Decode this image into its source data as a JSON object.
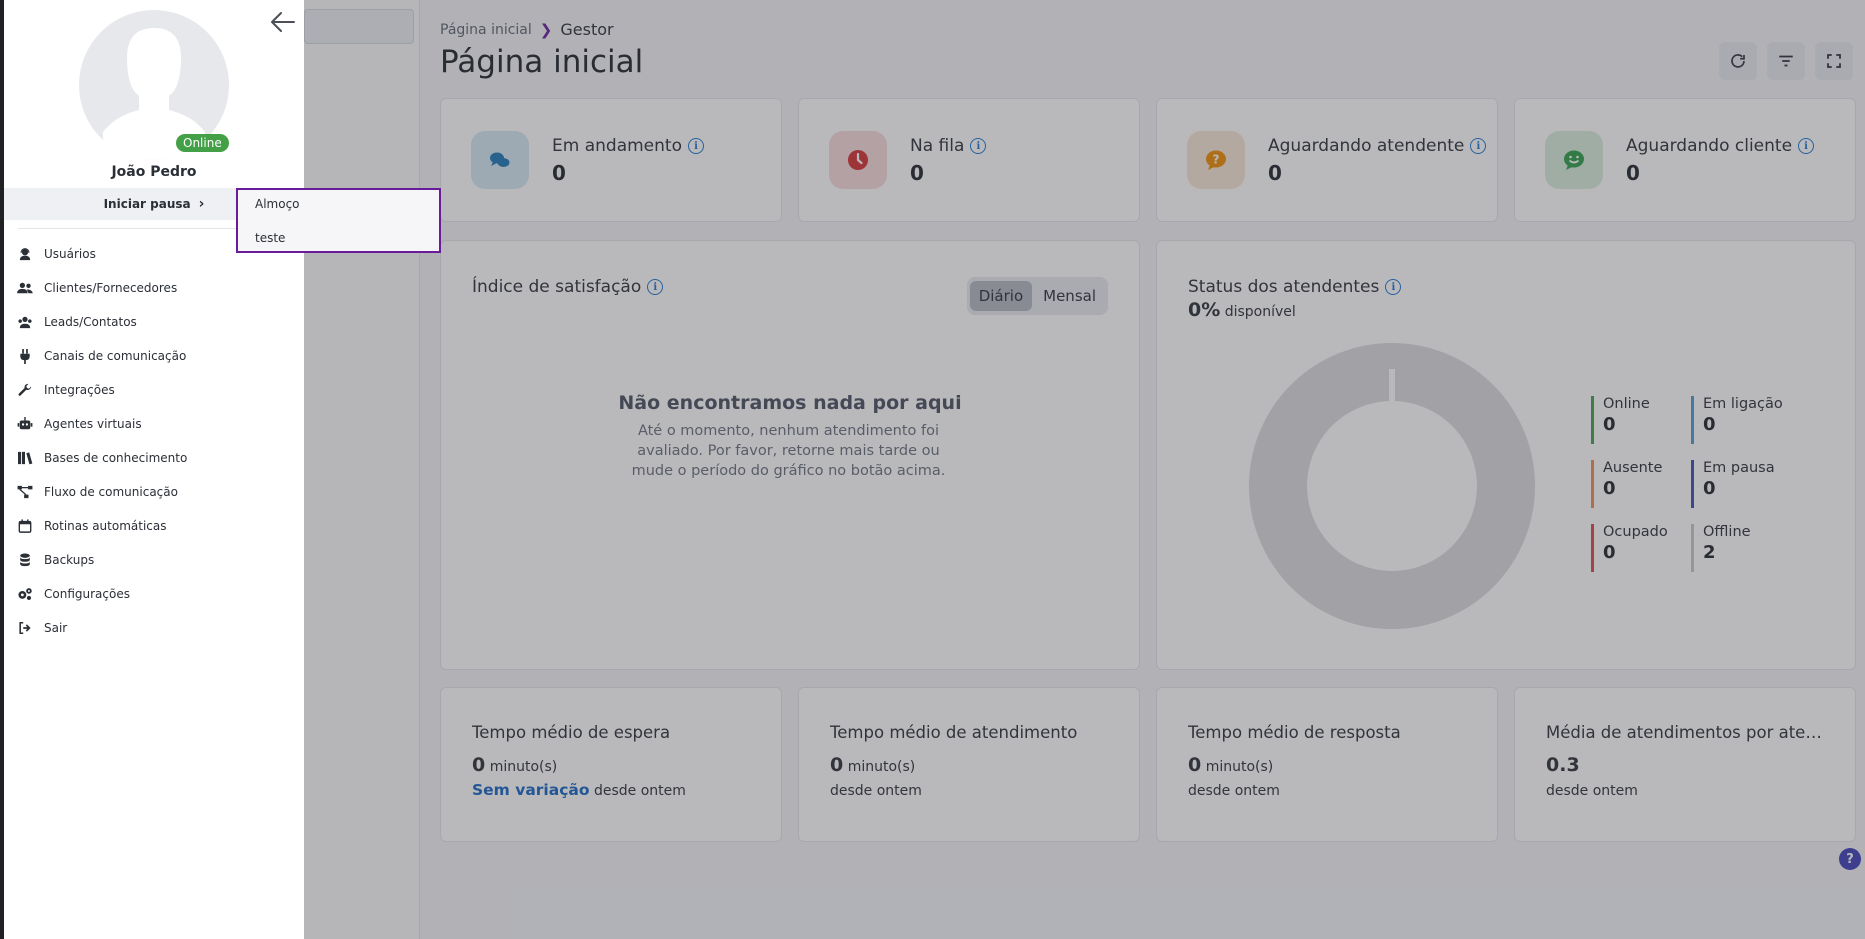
{
  "breadcrumb": {
    "home": "Página inicial",
    "current": "Gestor"
  },
  "page_title": "Página inicial",
  "stats": [
    {
      "label": "Em andamento",
      "value": "0",
      "icon": "chat-bubbles-icon",
      "color": "#1e78b4",
      "bg": "#d5e8f1"
    },
    {
      "label": "Na fila",
      "value": "0",
      "icon": "clock-icon",
      "color": "#d32f2f",
      "bg": "#f6d9da"
    },
    {
      "label": "Aguardando atendente",
      "value": "0",
      "icon": "question-bubble-icon",
      "color": "#ef8c00",
      "bg": "#f8e6d4"
    },
    {
      "label": "Aguardando cliente",
      "value": "0",
      "icon": "smile-bubble-icon",
      "color": "#2e9e47",
      "bg": "#d8ecdc"
    }
  ],
  "satisfaction": {
    "title": "Índice de satisfação",
    "toggle": {
      "daily": "Diário",
      "monthly": "Mensal"
    },
    "empty_title": "Não encontramos nada por aqui",
    "empty_text": "Até o momento, nenhum atendimento foi avaliado. Por favor, retorne mais tarde ou mude o período do gráfico no botão acima."
  },
  "agent_status": {
    "title": "Status dos atendentes",
    "percent": "0%",
    "percent_label": "disponível",
    "legend": [
      {
        "label": "Online",
        "value": "0",
        "color": "#43a047"
      },
      {
        "label": "Em ligação",
        "value": "0",
        "color": "#4a9bd6"
      },
      {
        "label": "Ausente",
        "value": "0",
        "color": "#ef8c4f"
      },
      {
        "label": "Em pausa",
        "value": "0",
        "color": "#3f4bb8"
      },
      {
        "label": "Ocupado",
        "value": "0",
        "color": "#d9484b"
      },
      {
        "label": "Offline",
        "value": "2",
        "color": "#c7c9ce"
      }
    ]
  },
  "metrics": [
    {
      "title": "Tempo médio de espera",
      "value": "0",
      "unit": "minuto(s)",
      "highlight": "Sem variação",
      "since": "desde ontem"
    },
    {
      "title": "Tempo médio de atendimento",
      "value": "0",
      "unit": "minuto(s)",
      "highlight": "",
      "since": "desde ontem"
    },
    {
      "title": "Tempo médio de resposta",
      "value": "0",
      "unit": "minuto(s)",
      "highlight": "",
      "since": "desde ontem"
    },
    {
      "title": "Média de atendimentos por atend...",
      "value": "0.3",
      "unit": "",
      "highlight": "",
      "since": "desde ontem"
    }
  ],
  "help_label": "?",
  "drawer": {
    "user_name": "João Pedro",
    "status_badge": "Online",
    "pause_label": "Iniciar pausa",
    "pause_options": [
      "Almoço",
      "teste"
    ],
    "menu": [
      {
        "label": "Usuários",
        "icon": "user-headset-icon"
      },
      {
        "label": "Clientes/Fornecedores",
        "icon": "users-icon"
      },
      {
        "label": "Leads/Contatos",
        "icon": "user-group-icon"
      },
      {
        "label": "Canais de comunicação",
        "icon": "plug-icon"
      },
      {
        "label": "Integrações",
        "icon": "wrench-icon"
      },
      {
        "label": "Agentes virtuais",
        "icon": "robot-icon"
      },
      {
        "label": "Bases de conhecimento",
        "icon": "books-icon"
      },
      {
        "label": "Fluxo de comunicação",
        "icon": "flow-icon"
      },
      {
        "label": "Rotinas automáticas",
        "icon": "calendar-icon"
      },
      {
        "label": "Backups",
        "icon": "database-icon"
      },
      {
        "label": "Configurações",
        "icon": "gears-icon"
      },
      {
        "label": "Sair",
        "icon": "sign-out-icon"
      }
    ]
  }
}
